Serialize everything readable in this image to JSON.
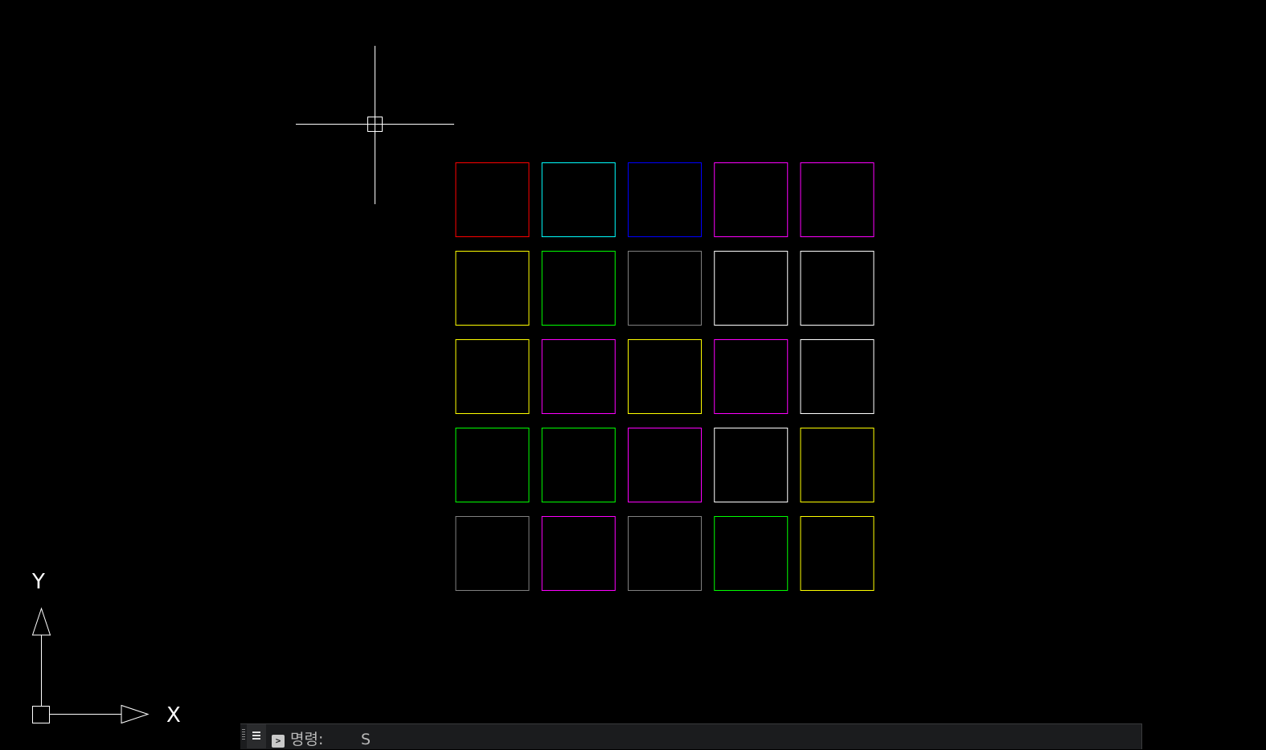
{
  "ucs": {
    "y_label": "Y",
    "x_label": "X",
    "color": "#ffffff"
  },
  "crosshair": {
    "color": "#ffffff"
  },
  "grid": {
    "rows": [
      [
        "#ff0000",
        "#00ffff",
        "#0000ff",
        "#ff00ff",
        "#ff00ff"
      ],
      [
        "#ffff00",
        "#00ff00",
        "#808080",
        "#ffffff",
        "#ffffff"
      ],
      [
        "#ffff00",
        "#ff00ff",
        "#ffff00",
        "#ff00ff",
        "#ffffff"
      ],
      [
        "#00ff00",
        "#00ff00",
        "#ff00ff",
        "#ffffff",
        "#ffff00"
      ],
      [
        "#808080",
        "#ff00ff",
        "#808080",
        "#00ff00",
        "#ffff00"
      ]
    ]
  },
  "command_line": {
    "prompt_icon": "command-prompt-icon",
    "prompt_label": "명령:",
    "input_value": "S"
  }
}
